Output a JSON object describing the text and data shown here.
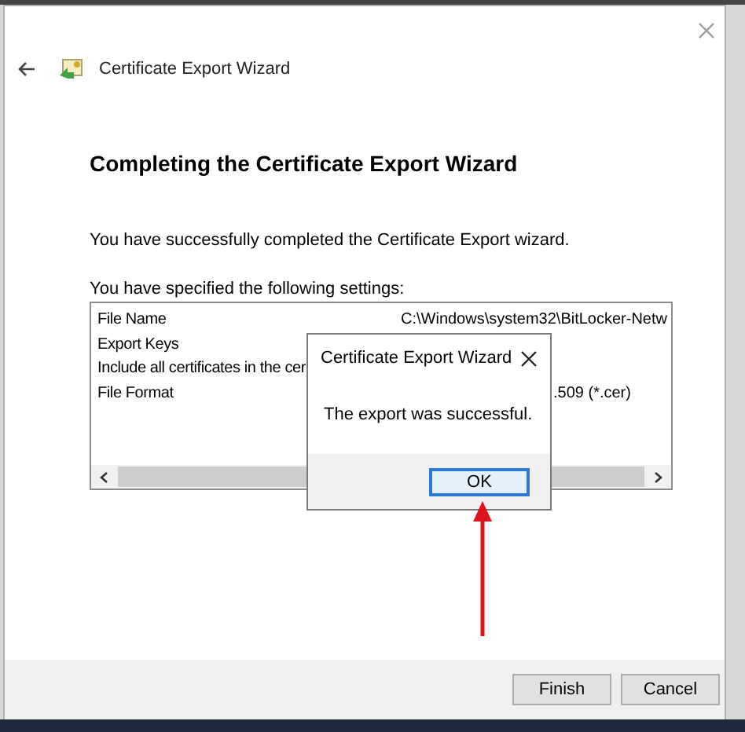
{
  "window": {
    "title": "Certificate Export Wizard"
  },
  "heading": "Completing the Certificate Export Wizard",
  "message": "You have successfully completed the Certificate Export wizard.",
  "settings_label": "You have specified the following settings:",
  "settings": [
    {
      "name": "File Name",
      "value": "C:\\Windows\\system32\\BitLocker-Netw"
    },
    {
      "name": "Export Keys"
    },
    {
      "name": "Include all certificates in the cer"
    },
    {
      "name": "File Format",
      "value": ".509 (*.cer)",
      "value_cut": true
    }
  ],
  "dialog": {
    "title": "Certificate Export Wizard",
    "message": "The export was successful.",
    "button": "OK"
  },
  "buttons": [
    {
      "label": "Finish"
    },
    {
      "label": "Cancel"
    }
  ]
}
